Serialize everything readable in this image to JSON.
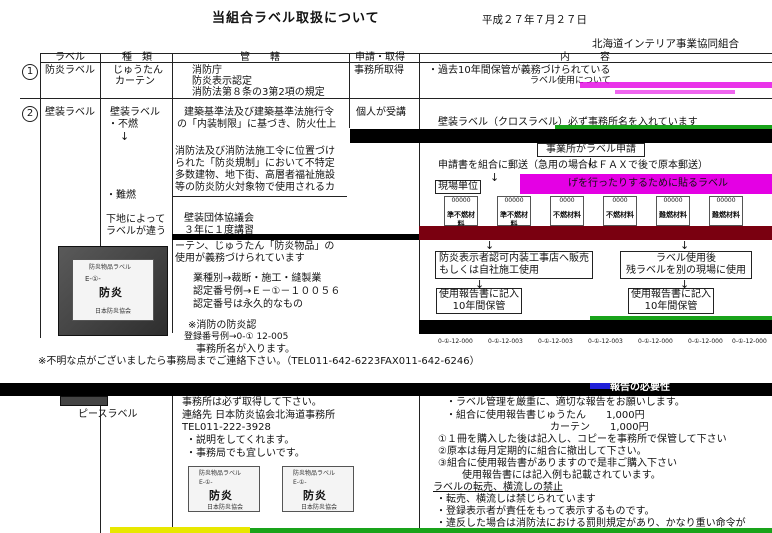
{
  "header": {
    "title": "当組合ラベル取扱について",
    "date": "平成２７年７月２７日",
    "org": "北海道インテリア事業協同組合"
  },
  "table": {
    "columns": [
      "ラベル",
      "種　類",
      "管　　轄",
      "申請・取得",
      "内　　　容"
    ]
  },
  "row1": {
    "num": "1",
    "label": "防炎ラベル",
    "kinds": [
      "じゅうたん",
      "カーテン"
    ],
    "jurisdiction": [
      "消防庁",
      "防炎表示認定",
      "消防法第８条の3第2項の規定"
    ],
    "apply": "事務所取得",
    "content": [
      "・過去10年間保管が義務づけられている",
      "ラベル使用について"
    ]
  },
  "row2": {
    "num": "2",
    "label": "壁装ラベル",
    "kinds": [
      "壁装ラベル",
      "・不燃",
      "・難燃",
      "下地によって",
      "ラベルが違う"
    ],
    "jurisdiction_top": [
      "建築基準法及び建築基準法施行令",
      "の「内装制限」に基づき、防火仕上"
    ],
    "jurisdiction_mid": [
      "消防法及び消防法施工令に位置づけ",
      "られた「防炎規制」において不特定",
      "多数建物、地下街、高層者福祉施設",
      "等の防炎防火対象物で使用されるカ"
    ],
    "jurisdiction_low": [
      "壁装団体協議会",
      "３年に１度講習"
    ],
    "jurisdiction_carpet": [
      "ーテン、じゅうたん「防炎物品」の",
      "使用が義務づけられています"
    ],
    "jurisdiction_cert": [
      "業種別→裁断・施工・縫製業",
      "認定番号例→Ｅ－①－１００５６",
      "認定番号は永久的なもの"
    ],
    "jurisdiction_note": [
      "※消防の防炎認",
      "登録番号例→0-① 12-005",
      "事務所名が入ります。"
    ],
    "apply": "個人が受講",
    "content_top": "壁装ラベル（クロスラベル）必ず事務所名を入れています",
    "flow_box1": "事業所がラベル申請",
    "flow_text1": "申請書を組合に郵送（急用の場合はＦＡＸで後で原本郵送）",
    "flow_unit": "現場単位",
    "flow_banner": "げを行ったりするために貼るラベル",
    "samples": [
      {
        "code": "00000",
        "name": "準不燃材料"
      },
      {
        "code": "00000",
        "name": "準不燃材料"
      },
      {
        "code": "0000",
        "name": "不燃材料"
      },
      {
        "code": "0000",
        "name": "不燃材料"
      },
      {
        "code": "00000",
        "name": "難燃材料"
      },
      {
        "code": "00000",
        "name": "難燃材料"
      }
    ],
    "flow_left": [
      "防炎表示者認可内装工事店へ販売",
      "もしくは自社施工使用"
    ],
    "flow_right": [
      "ラベル使用後",
      "残ラベルを別の現場に使用"
    ],
    "report_left": [
      "使用報告書に記入",
      "10年間保管"
    ],
    "report_right": [
      "使用報告書に記入",
      "10年間保管"
    ],
    "serials": [
      "0-①-12-000",
      "0-①-12-003",
      "0-①-12-003",
      "0-①-12-003",
      "0-①-12-000",
      "0-①-12-000",
      "0-①-12-000"
    ]
  },
  "stamp": {
    "top": "防炎物品ラベル",
    "code": "E-①-",
    "big": "防炎",
    "sub": "日本防炎協会"
  },
  "footer_note": "※不明な点がございましたら事務局までご連絡下さい。（TEL011-642-6223FAX011-642-6246）",
  "lower": {
    "piece_label": "ピースラベル",
    "left_lines": [
      "事務所は必ず取得して下さい。",
      "連絡先 日本防炎協会北海道事務所",
      "TEL011-222-3928",
      "・説明をしてくれます。",
      "・事務局でも宜しいです。"
    ],
    "header_bar": "報告の必要性",
    "right_lines": [
      "・ラベル管理を厳重に、適切な報告をお願いします。",
      "・組合に使用報告書じゅうたん　　1,000円",
      "カーテン　　1,000円",
      "①１冊を購入した後は記入し、コピーを事務所で保管して下さい",
      "②原本は毎月定期的に組合に撤出して下さい。",
      "③組合に使用報告書がありますので是非ご購入下さい",
      "使用報告書には記入例も記載されています。",
      "ラベルの転売、横流しの禁止",
      "・転売、横流しは禁じられています",
      "・登録表示者が責任をもって表示するものです。",
      "・違反した場合は消防法における罰則規定があり、かなり重い命令が"
    ]
  },
  "colors": {
    "black_band": "#000000",
    "magenta": "#e400e4",
    "dark_red": "#7a0010",
    "green": "#19a31a",
    "yellow": "#e8e800",
    "blue": "#1f1fd8"
  }
}
